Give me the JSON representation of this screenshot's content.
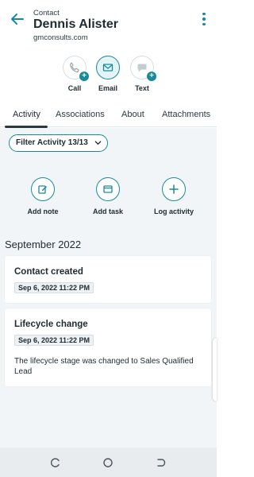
{
  "header": {
    "eyebrow": "Contact",
    "name": "Dennis  Alister",
    "subtitle": "gmconsults.com"
  },
  "quick_actions": [
    {
      "label": "Call",
      "icon": "phone-icon"
    },
    {
      "label": "Email",
      "icon": "email-icon"
    },
    {
      "label": "Text",
      "icon": "chat-icon"
    }
  ],
  "tabs": [
    {
      "label": "Activity"
    },
    {
      "label": "Associations"
    },
    {
      "label": "About"
    },
    {
      "label": "Attachments"
    }
  ],
  "filter": {
    "label": "Filter Activity 13/13"
  },
  "activity_actions": [
    {
      "label": "Add note",
      "icon": "edit-note-icon"
    },
    {
      "label": "Add task",
      "icon": "task-icon"
    },
    {
      "label": "Log activity",
      "icon": "plus-icon"
    }
  ],
  "timeline": {
    "month": "September 2022",
    "items": [
      {
        "title": "Contact created",
        "timestamp": "Sep 6, 2022 11:22 PM",
        "description": ""
      },
      {
        "title": "Lifecycle change",
        "timestamp": "Sep 6, 2022 11:22 PM",
        "description": "The lifecycle stage was changed to Sales Qualified Lead"
      }
    ]
  },
  "colors": {
    "accent": "#1a8a9a",
    "background": "#f1f5f8"
  }
}
